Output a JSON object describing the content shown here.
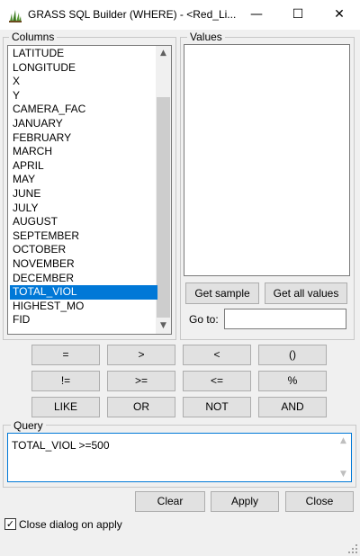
{
  "window": {
    "title": "GRASS SQL Builder (WHERE) - <Red_Li...",
    "minimize_glyph": "—",
    "maximize_glyph": "☐",
    "close_glyph": "✕",
    "icon": "grass-app-icon"
  },
  "columns": {
    "label": "Columns",
    "items": [
      {
        "label": "LATITUDE"
      },
      {
        "label": "LONGITUDE"
      },
      {
        "label": "X"
      },
      {
        "label": "Y"
      },
      {
        "label": "CAMERA_FAC"
      },
      {
        "label": "JANUARY"
      },
      {
        "label": "FEBRUARY"
      },
      {
        "label": "MARCH"
      },
      {
        "label": "APRIL"
      },
      {
        "label": "MAY"
      },
      {
        "label": "JUNE"
      },
      {
        "label": "JULY"
      },
      {
        "label": "AUGUST"
      },
      {
        "label": "SEPTEMBER"
      },
      {
        "label": "OCTOBER"
      },
      {
        "label": "NOVEMBER"
      },
      {
        "label": "DECEMBER"
      },
      {
        "label": "TOTAL_VIOL",
        "selected": true
      },
      {
        "label": "HIGHEST_MO"
      },
      {
        "label": "FID"
      }
    ],
    "scroll_up_glyph": "▲",
    "scroll_down_glyph": "▼"
  },
  "values": {
    "label": "Values",
    "get_sample_label": "Get sample",
    "get_all_values_label": "Get all values",
    "goto_label": "Go to:",
    "goto_value": ""
  },
  "operators": {
    "rows": [
      [
        "=",
        ">",
        "<",
        "()"
      ],
      [
        "!=",
        ">=",
        "<=",
        "%"
      ],
      [
        "LIKE",
        "OR",
        "NOT",
        "AND"
      ]
    ]
  },
  "query": {
    "label": "Query",
    "text": "TOTAL_VIOL >=500",
    "scroll_up_glyph": "▲",
    "scroll_down_glyph": "▼"
  },
  "actions": {
    "clear_label": "Clear",
    "apply_label": "Apply",
    "close_label": "Close"
  },
  "options": {
    "close_on_apply_label": "Close dialog on apply",
    "close_on_apply_checked": true,
    "check_glyph": "✓"
  },
  "colors": {
    "selection": "#0078d7",
    "window_bg": "#f0f0f0",
    "focus_border": "#0078d7"
  }
}
